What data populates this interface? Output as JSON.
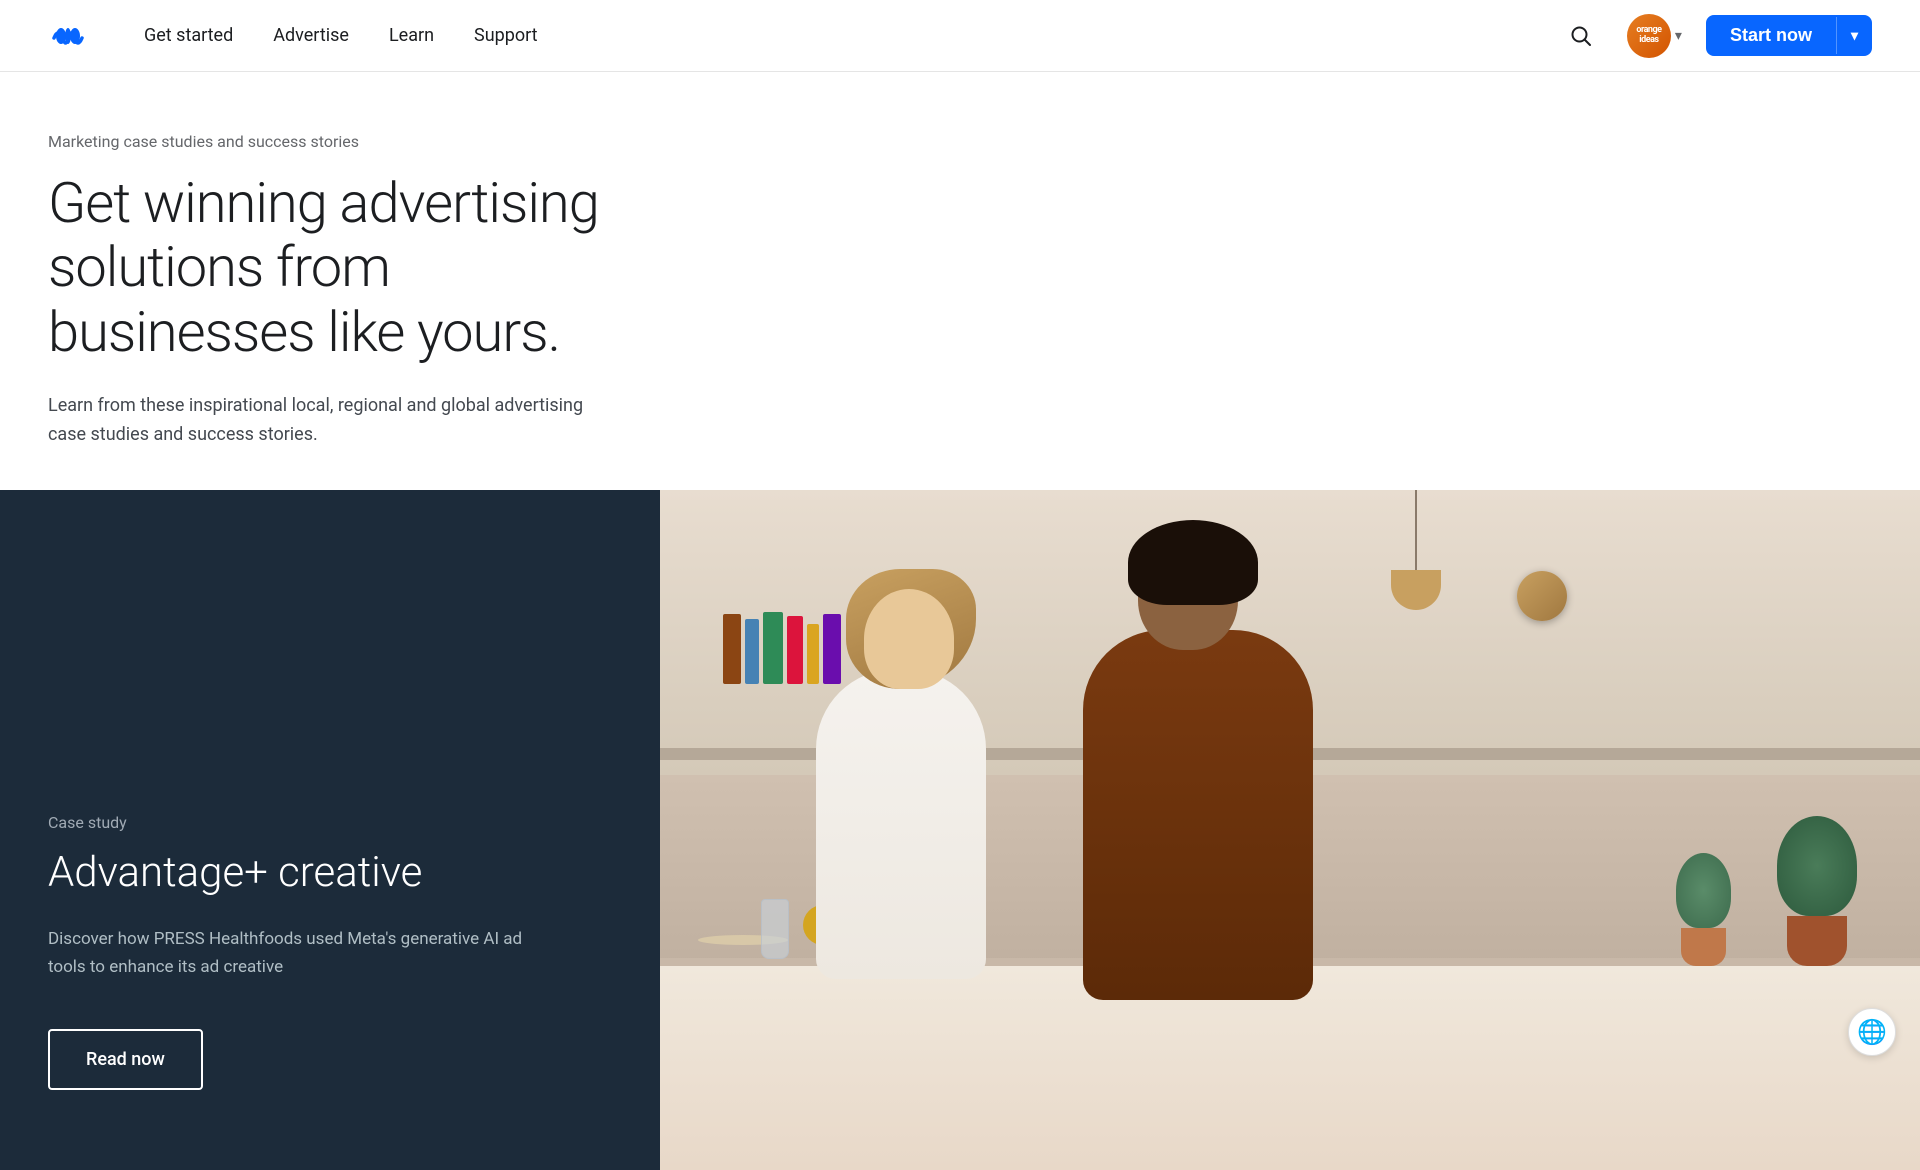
{
  "nav": {
    "logo_text": "Meta",
    "links": [
      {
        "id": "get-started",
        "label": "Get started"
      },
      {
        "id": "advertise",
        "label": "Advertise"
      },
      {
        "id": "learn",
        "label": "Learn"
      },
      {
        "id": "support",
        "label": "Support"
      }
    ],
    "user_avatar_text": "orange\nideas",
    "start_now_label": "Start now"
  },
  "hero": {
    "breadcrumb": "Marketing case studies and success stories",
    "title": "Get winning advertising solutions from businesses like yours.",
    "subtitle": "Learn from these inspirational local, regional and global advertising case studies and success stories."
  },
  "case_study": {
    "label": "Case study",
    "title": "Advantage+ creative",
    "description": "Discover how PRESS Healthfoods used Meta's generative AI ad tools to enhance its ad creative",
    "cta_label": "Read now"
  },
  "footer": {
    "globe_icon": "🌐"
  }
}
